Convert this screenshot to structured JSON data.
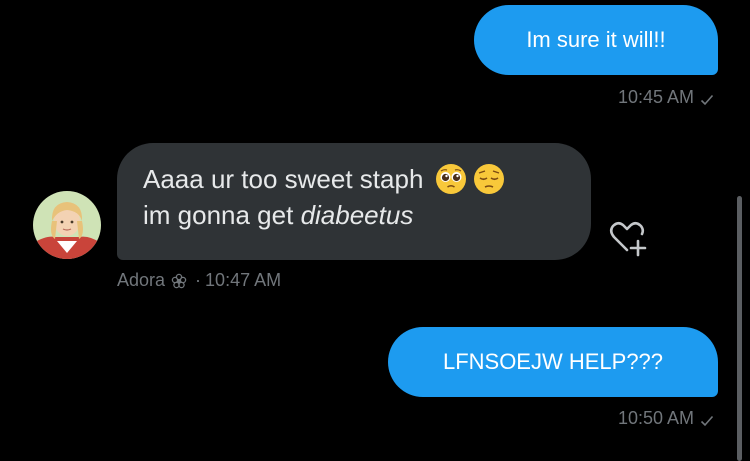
{
  "messages": {
    "m1": {
      "text": "Im sure it will!!",
      "time": "10:45 AM"
    },
    "m2": {
      "line1": "Aaaa ur too sweet staph",
      "line2_prefix": "im gonna get ",
      "line2_italic": "diabeetus",
      "emojis": [
        "pleading-face-icon",
        "pensive-face-icon"
      ],
      "sender": "Adora",
      "separator": "·",
      "time": "10:47 AM"
    },
    "m3": {
      "text": "LFNSOEJW HELP???",
      "time": "10:50 AM"
    }
  },
  "colors": {
    "outgoing_bubble": "#1d9bf0",
    "incoming_bubble": "#2f3336",
    "meta_text": "#71767b",
    "background": "#000000"
  }
}
